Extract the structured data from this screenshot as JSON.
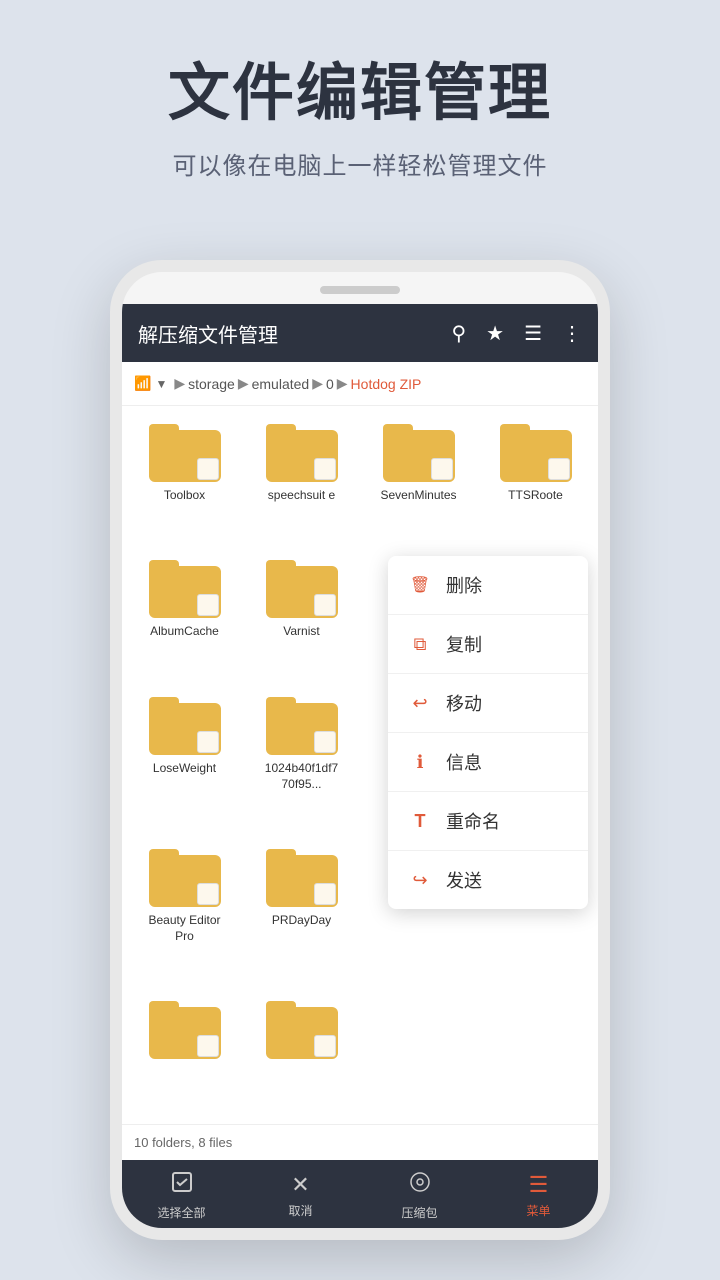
{
  "header": {
    "title": "文件编辑管理",
    "subtitle": "可以像在电脑上一样轻松管理文件"
  },
  "phone": {
    "appbar": {
      "title": "解压缩文件管理",
      "icons": [
        "search",
        "star",
        "menu",
        "more"
      ]
    },
    "breadcrumb": {
      "device": "storage",
      "path": [
        "emulated",
        "0"
      ],
      "active": "Hotdog ZIP"
    },
    "files": [
      {
        "name": "Toolbox",
        "type": "folder"
      },
      {
        "name": "speechsuit e",
        "type": "folder"
      },
      {
        "name": "SevenMinutes",
        "type": "folder"
      },
      {
        "name": "TTSRoote",
        "type": "folder"
      },
      {
        "name": "AlbumCache",
        "type": "folder"
      },
      {
        "name": "Varnist",
        "type": "folder"
      },
      {
        "name": "LoseWeight",
        "type": "folder"
      },
      {
        "name": "1024b40f1df770f95...",
        "type": "folder"
      },
      {
        "name": "Beauty Editor Pro",
        "type": "folder"
      },
      {
        "name": "PRDayDay",
        "type": "folder"
      },
      {
        "name": "",
        "type": "folder"
      },
      {
        "name": "",
        "type": "folder"
      }
    ],
    "context_menu": {
      "items": [
        {
          "icon": "delete",
          "label": "删除"
        },
        {
          "icon": "copy",
          "label": "复制"
        },
        {
          "icon": "move",
          "label": "移动"
        },
        {
          "icon": "info",
          "label": "信息"
        },
        {
          "icon": "rename",
          "label": "重命名"
        },
        {
          "icon": "send",
          "label": "发送"
        }
      ]
    },
    "statusbar": {
      "text": "10 folders, 8 files"
    },
    "bottomnav": [
      {
        "icon": "✓",
        "label": "选择全部",
        "active": false
      },
      {
        "icon": "✕",
        "label": "取消",
        "active": false
      },
      {
        "icon": "○",
        "label": "压缩包",
        "active": false
      },
      {
        "icon": "≡",
        "label": "菜单",
        "active": true
      }
    ]
  }
}
